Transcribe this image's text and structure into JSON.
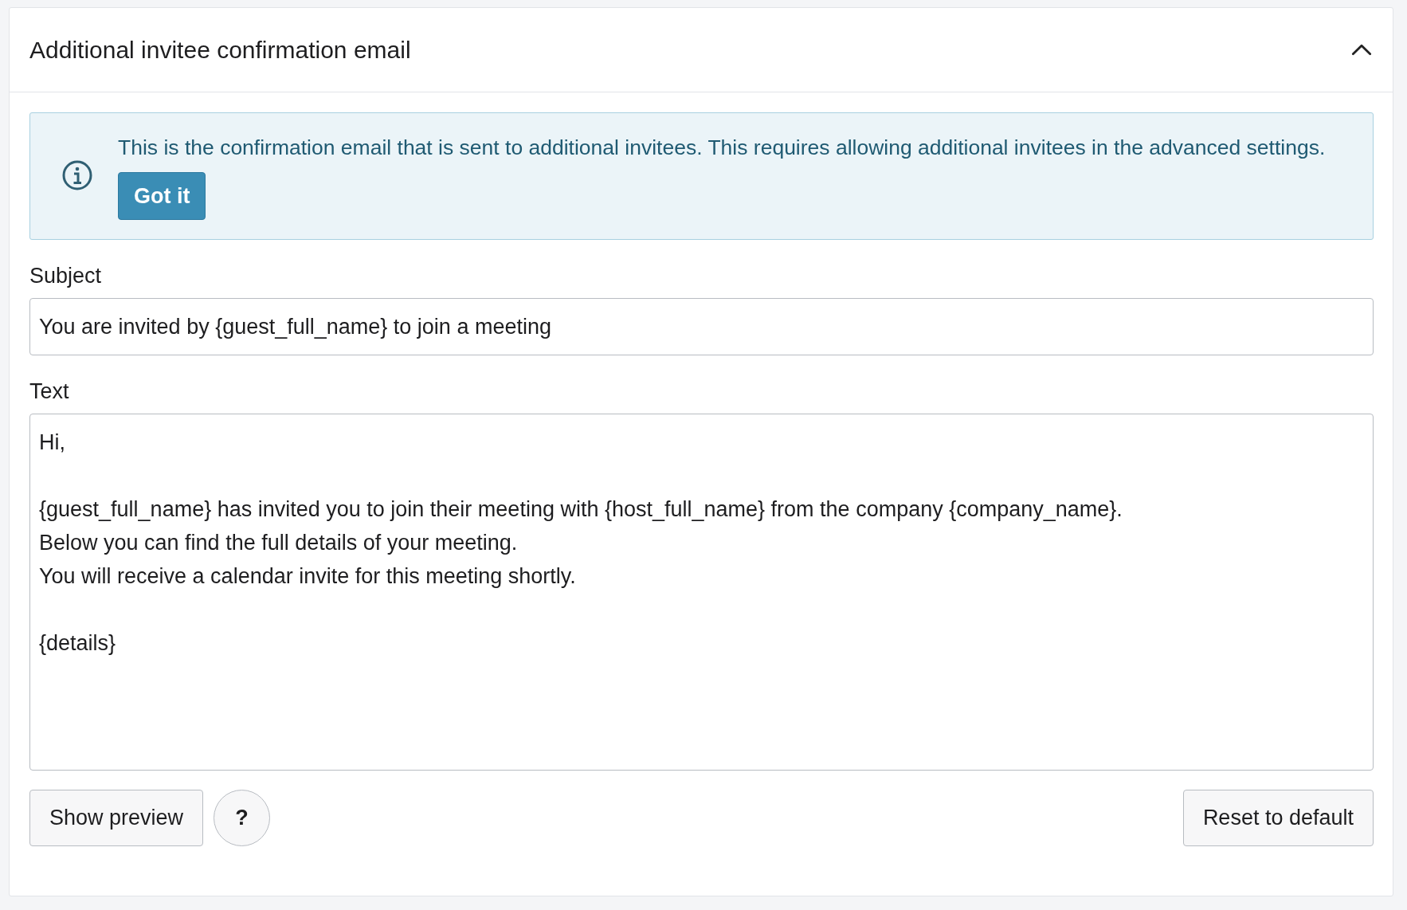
{
  "panel": {
    "title": "Additional invitee confirmation email",
    "expanded": true
  },
  "notice": {
    "text": "This is the confirmation email that is sent to additional invitees. This requires allowing additional invitees in the advanced settings.",
    "button": "Got it"
  },
  "subject": {
    "label": "Subject",
    "value": "You are invited by {guest_full_name} to join a meeting"
  },
  "body": {
    "label": "Text",
    "value": "Hi,\n\n{guest_full_name} has invited you to join their meeting with {host_full_name} from the company {company_name}.\nBelow you can find the full details of your meeting.\nYou will receive a calendar invite for this meeting shortly.\n\n{details}"
  },
  "actions": {
    "preview": "Show preview",
    "help": "?",
    "reset": "Reset to default"
  }
}
